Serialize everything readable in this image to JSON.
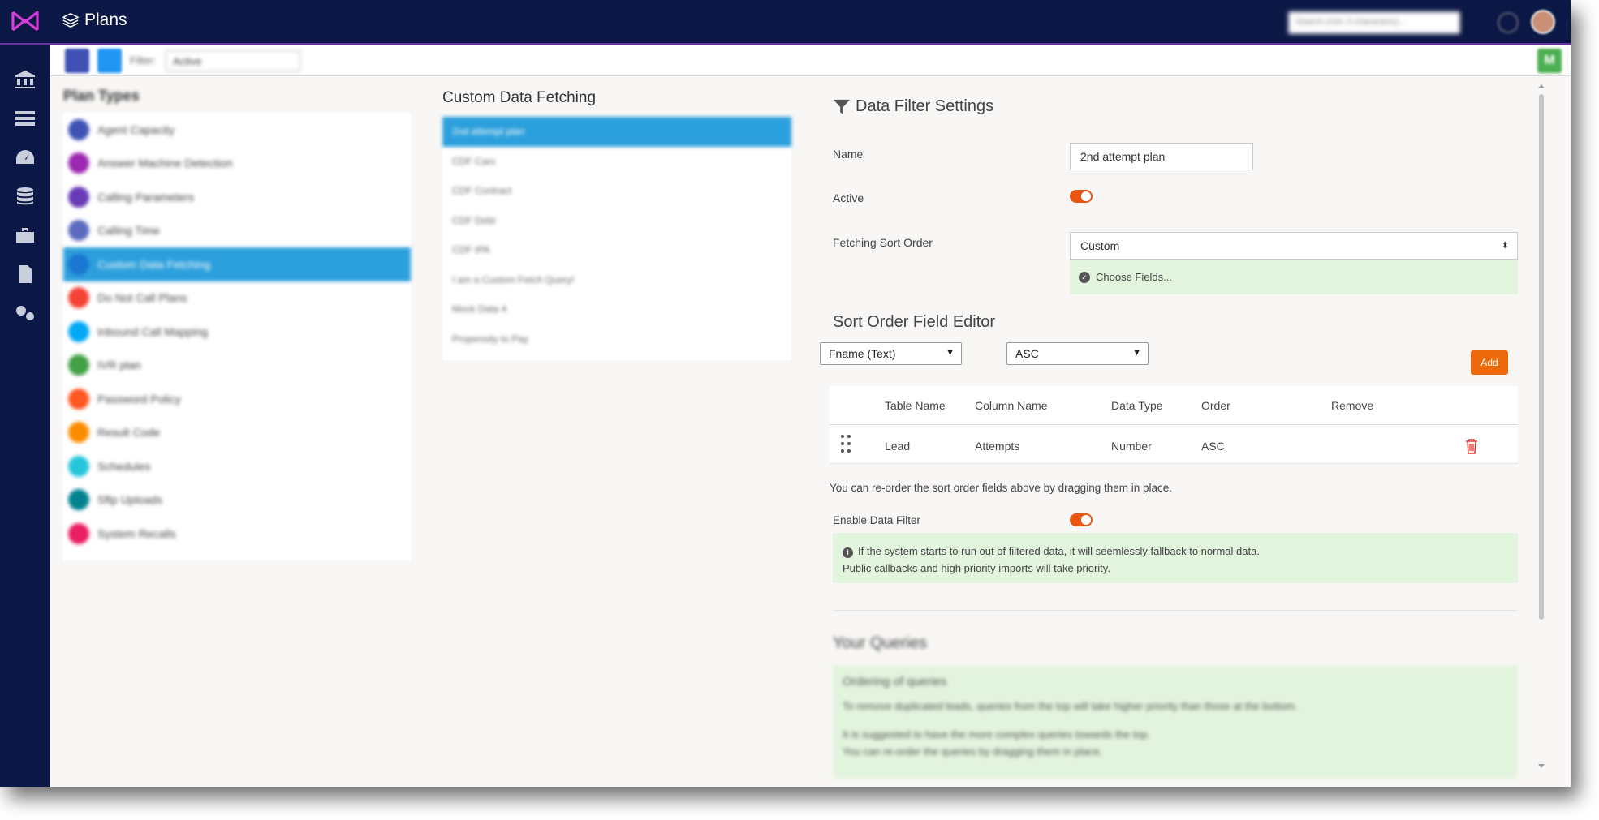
{
  "header": {
    "title": "Plans",
    "search_placeholder": "Search (min 3 characters)..."
  },
  "toolbar": {
    "filter_label": "Filter:",
    "filter_value": "Active"
  },
  "plan_types": {
    "title": "Plan Types",
    "items": [
      {
        "label": "Agent Capacity",
        "color": "#3f51b5"
      },
      {
        "label": "Answer Machine Detection",
        "color": "#9c27b0"
      },
      {
        "label": "Calling Parameters",
        "color": "#673ab7"
      },
      {
        "label": "Calling Time",
        "color": "#5c6bc0"
      },
      {
        "label": "Custom Data Fetching",
        "color": "#1976d2",
        "active": true
      },
      {
        "label": "Do Not Call Plans",
        "color": "#f44336"
      },
      {
        "label": "Inbound Call Mapping",
        "color": "#03a9f4"
      },
      {
        "label": "IVR plan",
        "color": "#43a047"
      },
      {
        "label": "Password Policy",
        "color": "#ff5722"
      },
      {
        "label": "Result Code",
        "color": "#fb8c00"
      },
      {
        "label": "Schedules",
        "color": "#26c6da"
      },
      {
        "label": "Sftp Uploads",
        "color": "#00838f"
      },
      {
        "label": "System Recalls",
        "color": "#e91e63"
      }
    ]
  },
  "fetching": {
    "title": "Custom Data Fetching",
    "items": [
      "2nd attempt plan",
      "CDF Cars",
      "CDF Contract",
      "CDF Debt",
      "CDF IPA",
      "I am a Custom Fetch Query!",
      "Mock Data 4",
      "Propensity to Pay"
    ]
  },
  "settings": {
    "title": "Data Filter Settings",
    "name_label": "Name",
    "name_value": "2nd attempt plan",
    "active_label": "Active",
    "sort_order_label": "Fetching Sort Order",
    "sort_order_value": "Custom",
    "choose_fields": "Choose Fields...",
    "editor_title": "Sort Order Field Editor",
    "field_select": "Fname (Text)",
    "order_select": "ASC",
    "add_label": "Add",
    "table": {
      "headers": [
        "Table Name",
        "Column Name",
        "Data Type",
        "Order",
        "Remove"
      ],
      "rows": [
        {
          "table": "Lead",
          "column": "Attempts",
          "type": "Number",
          "order": "ASC"
        }
      ]
    },
    "reorder_note": "You can re-order the sort order fields above by dragging them in place.",
    "enable_filter_label": "Enable Data Filter",
    "info_line1": "If the system starts to run out of filtered data, it will seemlessly fallback to normal data.",
    "info_line2": "Public callbacks and high priority imports will take priority."
  },
  "queries": {
    "title": "Your Queries",
    "heading": "Ordering of queries",
    "line1": "To remove duplicated leads, queries from the top will take higher priority than those at the bottom.",
    "line2": "It is suggested to have the more complex queries towards the top.",
    "line3": "You can re-order the queries by dragging them in place."
  },
  "colors": {
    "nav_bg": "#0b1745",
    "accent": "#6d2ea1",
    "selected": "#2b9fdc",
    "toggle": "#e85614",
    "add_button": "#ec6a0b",
    "info_bg": "#e3f4de"
  }
}
